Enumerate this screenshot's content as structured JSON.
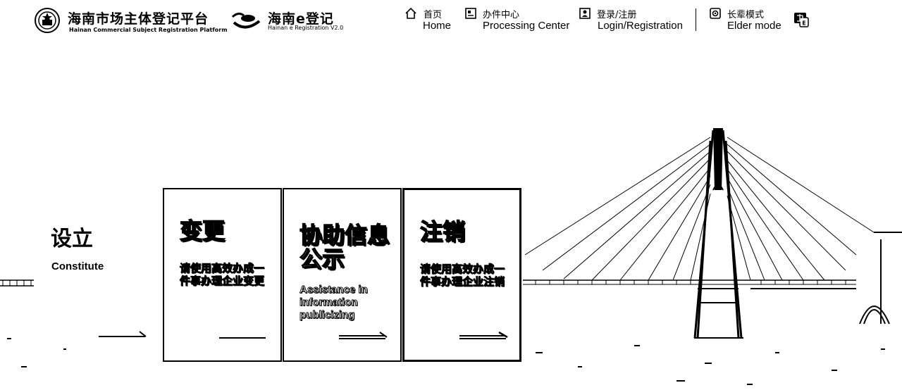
{
  "header": {
    "logo": {
      "title_cn": "海南市场主体登记平台",
      "title_en": "Hainan Commercial Subject Registration Platform"
    },
    "ereg": {
      "title_cn": "海南e登记",
      "title_en": "Hainan e Registration V2.0"
    },
    "nav": [
      {
        "cn": "首页",
        "en": "Home",
        "icon": "home-icon"
      },
      {
        "cn": "办件中心",
        "en": "Processing Center",
        "icon": "document-icon"
      },
      {
        "cn": "登录/注册",
        "en": "Login/Registration",
        "icon": "user-card-icon"
      },
      {
        "cn": "长辈模式",
        "en": "Elder mode",
        "icon": "elder-mode-icon"
      }
    ],
    "lang_icon": "language-switch-icon"
  },
  "services": {
    "setup": {
      "title": "设立",
      "subtitle": "Constitute"
    },
    "cards": [
      {
        "title": "变更",
        "desc": "请使用高效办成一件事办理企业变更"
      },
      {
        "title": "协助信息公示",
        "desc": "Assistance in information publicizing"
      },
      {
        "title": "注销",
        "desc": "请使用高效办成一件事办理企业注销"
      }
    ]
  }
}
